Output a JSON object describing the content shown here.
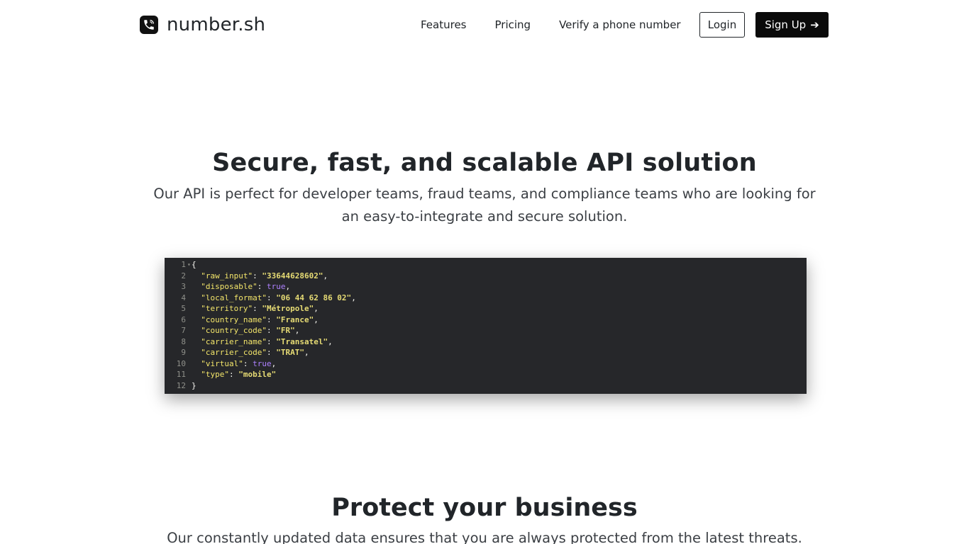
{
  "nav": {
    "brand": "number.sh",
    "links": [
      "Features",
      "Pricing",
      "Verify a phone number"
    ],
    "login_label": "Login",
    "signup_label": "Sign Up",
    "signup_icon": "arrow-right-icon",
    "brand_icon": "phone-icon"
  },
  "hero": {
    "title": "Secure, fast, and scalable API solution",
    "subtitle": "Our API is perfect for developer teams, fraud teams, and compliance teams who are looking for an easy-to-integrate and secure solution."
  },
  "code_sample": {
    "lines": [
      {
        "num": "1",
        "open": "{"
      },
      {
        "num": "2",
        "key": "\"raw_input\"",
        "value": "\"33644628602\"",
        "kind": "str",
        "comma": ","
      },
      {
        "num": "3",
        "key": "\"disposable\"",
        "value": "true",
        "kind": "bool",
        "comma": ","
      },
      {
        "num": "4",
        "key": "\"local_format\"",
        "value": "\"06 44 62 86 02\"",
        "kind": "str",
        "comma": ","
      },
      {
        "num": "5",
        "key": "\"territory\"",
        "value": "\"Métropole\"",
        "kind": "str",
        "comma": ","
      },
      {
        "num": "6",
        "key": "\"country_name\"",
        "value": "\"France\"",
        "kind": "str",
        "comma": ","
      },
      {
        "num": "7",
        "key": "\"country_code\"",
        "value": "\"FR\"",
        "kind": "str",
        "comma": ","
      },
      {
        "num": "8",
        "key": "\"carrier_name\"",
        "value": "\"Transatel\"",
        "kind": "str",
        "comma": ","
      },
      {
        "num": "9",
        "key": "\"carrier_code\"",
        "value": "\"TRAT\"",
        "kind": "str",
        "comma": ","
      },
      {
        "num": "10",
        "key": "\"virtual\"",
        "value": "true",
        "kind": "bool",
        "comma": ","
      },
      {
        "num": "11",
        "key": "\"type\"",
        "value": "\"mobile\"",
        "kind": "str",
        "comma": ""
      },
      {
        "num": "12",
        "close": "}"
      }
    ]
  },
  "protect": {
    "title": "Protect your business",
    "subtitle": "Our constantly updated data ensures that you are always protected from the latest threats."
  },
  "colors": {
    "code_bg": "#26272a",
    "key": "#f3e56a",
    "string": "#e6db74",
    "bool": "#ae81ff",
    "gutter": "#8f908a"
  }
}
